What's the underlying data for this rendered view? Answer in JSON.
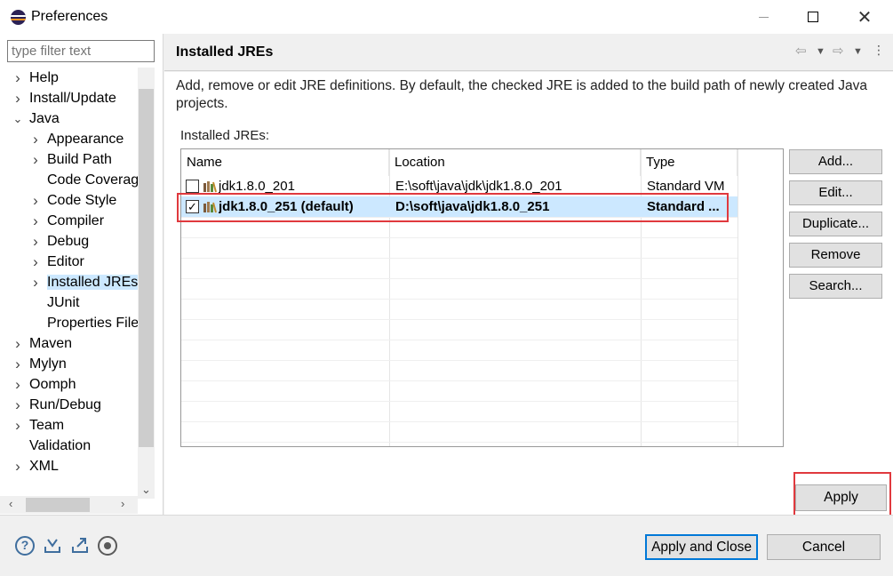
{
  "window": {
    "title": "Preferences",
    "close_glyph": "✕"
  },
  "sidebar": {
    "filter_placeholder": "type filter text",
    "items": [
      {
        "label": "Help",
        "level": 0,
        "expandable": true,
        "expanded": false
      },
      {
        "label": "Install/Update",
        "level": 0,
        "expandable": true,
        "expanded": false
      },
      {
        "label": "Java",
        "level": 0,
        "expandable": true,
        "expanded": true
      },
      {
        "label": "Appearance",
        "level": 1,
        "expandable": true,
        "expanded": false
      },
      {
        "label": "Build Path",
        "level": 1,
        "expandable": true,
        "expanded": false
      },
      {
        "label": "Code Coverage",
        "level": 1,
        "expandable": false
      },
      {
        "label": "Code Style",
        "level": 1,
        "expandable": true,
        "expanded": false
      },
      {
        "label": "Compiler",
        "level": 1,
        "expandable": true,
        "expanded": false
      },
      {
        "label": "Debug",
        "level": 1,
        "expandable": true,
        "expanded": false
      },
      {
        "label": "Editor",
        "level": 1,
        "expandable": true,
        "expanded": false
      },
      {
        "label": "Installed JREs",
        "level": 1,
        "expandable": true,
        "expanded": false,
        "selected": true
      },
      {
        "label": "JUnit",
        "level": 1,
        "expandable": false
      },
      {
        "label": "Properties Files Editor",
        "level": 1,
        "expandable": false
      },
      {
        "label": "Maven",
        "level": 0,
        "expandable": true,
        "expanded": false
      },
      {
        "label": "Mylyn",
        "level": 0,
        "expandable": true,
        "expanded": false
      },
      {
        "label": "Oomph",
        "level": 0,
        "expandable": true,
        "expanded": false
      },
      {
        "label": "Run/Debug",
        "level": 0,
        "expandable": true,
        "expanded": false
      },
      {
        "label": "Team",
        "level": 0,
        "expandable": true,
        "expanded": false
      },
      {
        "label": "Validation",
        "level": 0,
        "expandable": false
      },
      {
        "label": "XML",
        "level": 0,
        "expandable": true,
        "expanded": false
      }
    ]
  },
  "page": {
    "title": "Installed JREs",
    "description": "Add, remove or edit JRE definitions. By default, the checked JRE is added to the build path of newly created Java projects.",
    "table_label": "Installed JREs:",
    "columns": [
      "Name",
      "Location",
      "Type"
    ],
    "rows": [
      {
        "name": "jdk1.8.0_201",
        "location": "E:\\soft\\java\\jdk\\jdk1.8.0_201",
        "type": "Standard VM",
        "checked": false,
        "selected": false
      },
      {
        "name": "jdk1.8.0_251 (default)",
        "location": "D:\\soft\\java\\jdk1.8.0_251",
        "type": "Standard ...",
        "checked": true,
        "selected": true
      }
    ],
    "buttons": {
      "add": "Add...",
      "edit": "Edit...",
      "duplicate": "Duplicate...",
      "remove": "Remove",
      "search": "Search..."
    },
    "apply": "Apply"
  },
  "footer": {
    "apply_and_close": "Apply and Close",
    "cancel": "Cancel"
  },
  "icons": {
    "help": "?",
    "checkmark": "✓"
  },
  "colors": {
    "selection": "#cce8ff",
    "annotation": "#e0393e",
    "default_button_border": "#0078d7"
  }
}
